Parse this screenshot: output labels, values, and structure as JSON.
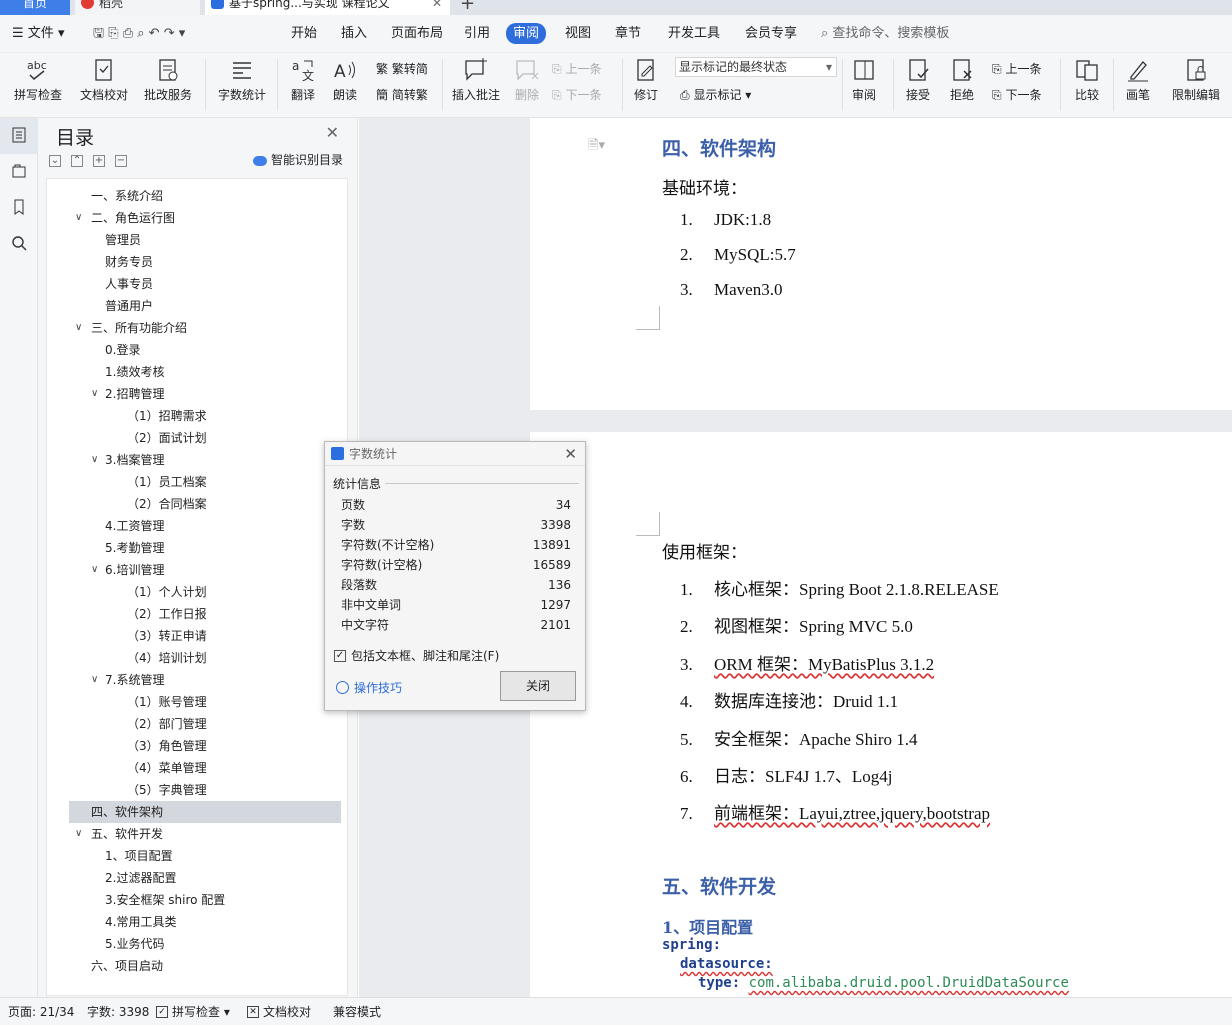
{
  "tabs": [
    {
      "label": "首页"
    },
    {
      "label": "稻壳"
    },
    {
      "label": "基于spring...与实现 课程论文"
    }
  ],
  "menu": {
    "file": "文件",
    "items": [
      "开始",
      "插入",
      "页面布局",
      "引用",
      "审阅",
      "视图",
      "章节",
      "开发工具",
      "会员专享"
    ],
    "search": "查找命令、搜索模板"
  },
  "ribbon": {
    "spell": "拼写检查",
    "doc_check": "文档校对",
    "review_service": "批改服务",
    "word_count": "字数统计",
    "translate": "翻译",
    "read_aloud": "朗读",
    "trad": "繁转简",
    "simp": "简转繁",
    "insert_comment": "插入批注",
    "delete": "删除",
    "prev_comment": "上一条",
    "next_comment": "下一条",
    "revise": "修订",
    "show_markup_select": "显示标记的最终状态",
    "show_markup": "显示标记",
    "review": "审阅",
    "accept": "接受",
    "reject": "拒绝",
    "prev": "上一条",
    "next": "下一条",
    "compare": "比较",
    "ink": "画笔",
    "restrict": "限制编辑"
  },
  "toc": {
    "title": "目录",
    "smart": "智能识别目录",
    "items": [
      {
        "text": "一、系统介绍",
        "level": 1,
        "arrow": ""
      },
      {
        "text": "二、角色运行图",
        "level": 1,
        "arrow": "v"
      },
      {
        "text": "管理员",
        "level": 2,
        "arrow": ""
      },
      {
        "text": "财务专员",
        "level": 2,
        "arrow": ""
      },
      {
        "text": "人事专员",
        "level": 2,
        "arrow": ""
      },
      {
        "text": "普通用户",
        "level": 2,
        "arrow": ""
      },
      {
        "text": "三、所有功能介绍",
        "level": 1,
        "arrow": "v"
      },
      {
        "text": "0.登录",
        "level": 2,
        "arrow": ""
      },
      {
        "text": "1.绩效考核",
        "level": 2,
        "arrow": ""
      },
      {
        "text": "2.招聘管理",
        "level": 2,
        "arrow": "v"
      },
      {
        "text": "（1）招聘需求",
        "level": 3,
        "arrow": ""
      },
      {
        "text": "（2）面试计划",
        "level": 3,
        "arrow": ""
      },
      {
        "text": "3.档案管理",
        "level": 2,
        "arrow": "v"
      },
      {
        "text": "（1）员工档案",
        "level": 3,
        "arrow": ""
      },
      {
        "text": "（2）合同档案",
        "level": 3,
        "arrow": ""
      },
      {
        "text": "4.工资管理",
        "level": 2,
        "arrow": ""
      },
      {
        "text": "5.考勤管理",
        "level": 2,
        "arrow": ""
      },
      {
        "text": "6.培训管理",
        "level": 2,
        "arrow": "v"
      },
      {
        "text": "（1）个人计划",
        "level": 3,
        "arrow": ""
      },
      {
        "text": "（2）工作日报",
        "level": 3,
        "arrow": ""
      },
      {
        "text": "（3）转正申请",
        "level": 3,
        "arrow": ""
      },
      {
        "text": "（4）培训计划",
        "level": 3,
        "arrow": ""
      },
      {
        "text": "7.系统管理",
        "level": 2,
        "arrow": "v"
      },
      {
        "text": "（1）账号管理",
        "level": 3,
        "arrow": ""
      },
      {
        "text": "（2）部门管理",
        "level": 3,
        "arrow": ""
      },
      {
        "text": "（3）角色管理",
        "level": 3,
        "arrow": ""
      },
      {
        "text": "（4）菜单管理",
        "level": 3,
        "arrow": ""
      },
      {
        "text": "（5）字典管理",
        "level": 3,
        "arrow": ""
      },
      {
        "text": "四、软件架构",
        "level": 1,
        "arrow": "",
        "selected": true
      },
      {
        "text": "五、软件开发",
        "level": 1,
        "arrow": "v"
      },
      {
        "text": "1、项目配置",
        "level": 2,
        "arrow": ""
      },
      {
        "text": "2.过滤器配置",
        "level": 2,
        "arrow": ""
      },
      {
        "text": "3.安全框架 shiro 配置",
        "level": 2,
        "arrow": ""
      },
      {
        "text": "4.常用工具类",
        "level": 2,
        "arrow": ""
      },
      {
        "text": "5.业务代码",
        "level": 2,
        "arrow": ""
      },
      {
        "text": "六、项目启动",
        "level": 1,
        "arrow": ""
      }
    ]
  },
  "doc": {
    "h_arch": "四、软件架构",
    "base_env": "基础环境：",
    "env_list": [
      {
        "n": "1.",
        "t": "JDK:1.8"
      },
      {
        "n": "2.",
        "t": "MySQL:5.7"
      },
      {
        "n": "3.",
        "t": "Maven3.0"
      }
    ],
    "frameworks": "使用框架：",
    "fw_list": [
      {
        "n": "1.",
        "t": "核心框架：Spring Boot 2.1.8.RELEASE"
      },
      {
        "n": "2.",
        "t": "视图框架：Spring MVC 5.0"
      },
      {
        "n": "3.",
        "t": "ORM 框架：MyBatisPlus 3.1.2"
      },
      {
        "n": "4.",
        "t": "数据库连接池：Druid 1.1"
      },
      {
        "n": "5.",
        "t": "安全框架：Apache Shiro 1.4"
      },
      {
        "n": "6.",
        "t": "日志：SLF4J 1.7、Log4j"
      },
      {
        "n": "7.",
        "t": "前端框架：Layui,ztree,jquery,bootstrap"
      }
    ],
    "h_dev": "五、软件开发",
    "h_cfg": "1、项目配置",
    "code": [
      {
        "k": "spring:",
        "v": ""
      },
      {
        "k": "datasource:",
        "v": ""
      },
      {
        "k": "type:",
        "v": "com.alibaba.druid.pool.DruidDataSource"
      }
    ]
  },
  "dialog": {
    "title": "字数统计",
    "section": "统计信息",
    "rows": [
      {
        "label": "页数",
        "value": "34"
      },
      {
        "label": "字数",
        "value": "3398"
      },
      {
        "label": "字符数(不计空格)",
        "value": "13891"
      },
      {
        "label": "字符数(计空格)",
        "value": "16589"
      },
      {
        "label": "段落数",
        "value": "136"
      },
      {
        "label": "非中文单词",
        "value": "1297"
      },
      {
        "label": "中文字符",
        "value": "2101"
      }
    ],
    "include": "包括文本框、脚注和尾注(F)",
    "tips": "操作技巧",
    "close": "关闭"
  },
  "status": {
    "page": "页面: 21/34",
    "words": "字数: 3398",
    "spell": "拼写检查",
    "doc_check": "文档校对",
    "compat": "兼容模式"
  }
}
